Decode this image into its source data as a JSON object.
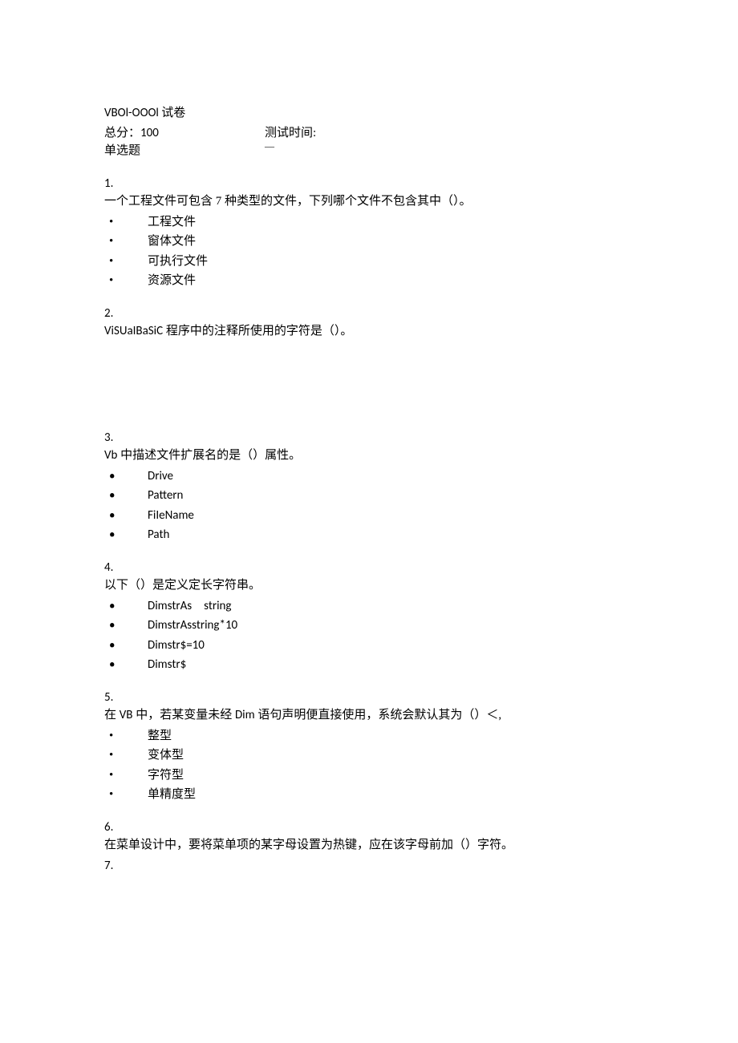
{
  "header": {
    "title": "VBOl-OOOl 试卷",
    "score_label": "总分：",
    "score_value": "100",
    "time_label": "测试时间:",
    "time_dash": "—",
    "section": "单选题"
  },
  "questions": [
    {
      "num": "1.",
      "text": "一个工程文件可包含 7 种类型的文件，下列哪个文件不包含其中（）。",
      "latin": false,
      "options": [
        "工程文件",
        "窗体文件",
        "可执行文件",
        "资源文件"
      ],
      "options_latin": false
    },
    {
      "num": "2.",
      "text_prefix": "ViSUaIBaSiC",
      "text": " 程序中的注释所使用的字符是（）。",
      "latin_prefix": true,
      "options": [],
      "extra_space": true
    },
    {
      "num": "3.",
      "text_prefix": "Vb",
      "text": " 中描述文件扩展名的是（）属性。",
      "latin_prefix": true,
      "options": [
        "Drive",
        "Pattern",
        "FiIeName",
        "Path"
      ],
      "options_latin": true
    },
    {
      "num": "4.",
      "text": "以下（）是定义定长字符串。",
      "latin": false,
      "options": [
        "DimstrAs　string",
        "DimstrAsstring*10",
        "Dimstr$=10",
        "Dimstr$"
      ],
      "options_latin": true
    },
    {
      "num": "5.",
      "text_prefix_cn": "在 ",
      "text_mid": "VB",
      "text_mid2": " 中，若某变量未经 ",
      "text_mid3": "Dim",
      "text_suffix": " 语句声明便直接使用，系统会默认其为（）＜,",
      "mixed": true,
      "options": [
        "整型",
        "变体型",
        "字符型",
        "单精度型"
      ],
      "options_latin": false
    },
    {
      "num": "6.",
      "text": "在菜单设计中，要将菜单项的某字母设置为热键，应在该字母前加（）字符。",
      "latin": false,
      "options": []
    },
    {
      "num": "7.",
      "text": "",
      "options": []
    }
  ]
}
